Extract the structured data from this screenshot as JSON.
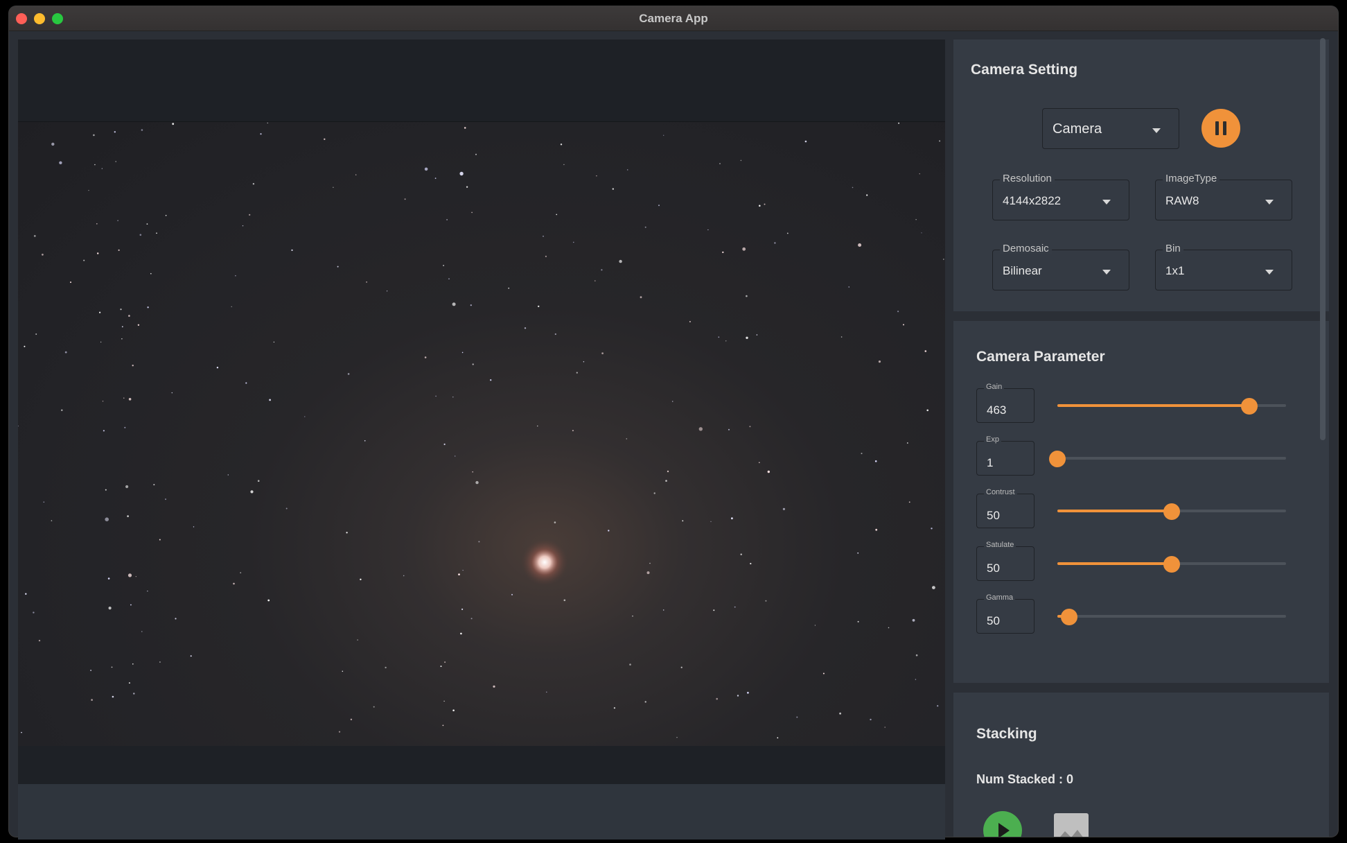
{
  "window": {
    "title": "Camera App"
  },
  "camera_setting": {
    "title": "Camera Setting",
    "camera_select": {
      "value": "Camera"
    },
    "resolution": {
      "label": "Resolution",
      "value": "4144x2822"
    },
    "image_type": {
      "label": "ImageType",
      "value": "RAW8"
    },
    "demosaic": {
      "label": "Demosaic",
      "value": "Bilinear"
    },
    "bin": {
      "label": "Bin",
      "value": "1x1"
    }
  },
  "camera_parameter": {
    "title": "Camera Parameter",
    "params": [
      {
        "label": "Gain",
        "value": "463",
        "slider_fraction": 0.84
      },
      {
        "label": "Exp",
        "value": "1",
        "slider_fraction": 0.0
      },
      {
        "label": "Contrust",
        "value": "50",
        "slider_fraction": 0.5
      },
      {
        "label": "Satulate",
        "value": "50",
        "slider_fraction": 0.5
      },
      {
        "label": "Gamma",
        "value": "50",
        "slider_fraction": 0.05
      }
    ]
  },
  "stacking": {
    "title": "Stacking",
    "num_stacked_text": "Num Stacked : 0"
  },
  "colors": {
    "accent": "#f0923a",
    "play": "#4caf50",
    "panel_bg": "#353b44",
    "window_bg": "#2b2f36"
  },
  "icons": {
    "pause": "pause-icon",
    "dropdown": "chevron-down-icon",
    "play": "play-icon",
    "image": "image-icon"
  }
}
